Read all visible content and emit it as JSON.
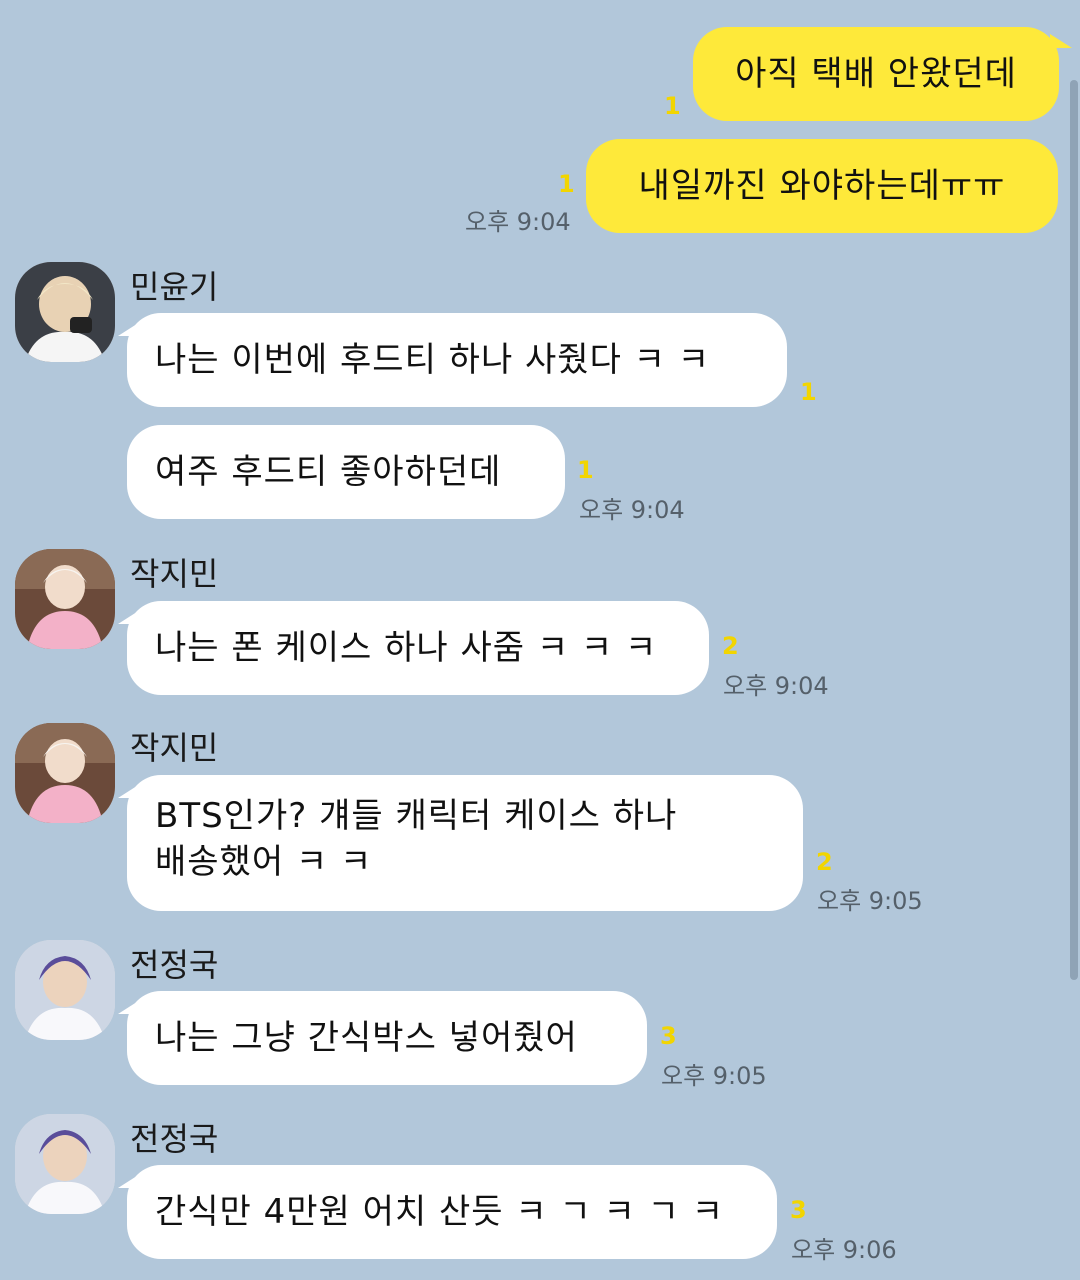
{
  "colors": {
    "background": "#b2c7da",
    "my_bubble": "#fee93a",
    "other_bubble": "#ffffff",
    "unread": "#f2d500",
    "time_text": "#55606a"
  },
  "messages": [
    {
      "text": "아직 택배 안왔던데",
      "unread": "1"
    },
    {
      "text": "내일까진 와야하는데ㅠㅠ",
      "unread": "1",
      "time": "오후 9:04"
    },
    {
      "sender": "민윤기",
      "text": "나는 이번에 후드티 하나 사줬다 ㅋ ㅋ",
      "unread": "1"
    },
    {
      "text": "여주 후드티 좋아하던데",
      "unread": "1",
      "time": "오후 9:04"
    },
    {
      "sender": "작지민",
      "text": "나는 폰 케이스 하나 사줌 ㅋ ㅋ ㅋ",
      "unread": "2",
      "time": "오후 9:04"
    },
    {
      "sender": "작지민",
      "text": "BTS인가? 걔들 캐릭터 케이스 하나\n배송했어 ㅋ ㅋ",
      "unread": "2",
      "time": "오후 9:05"
    },
    {
      "sender": "전정국",
      "text": "나는 그냥 간식박스 넣어줬어",
      "unread": "3",
      "time": "오후 9:05"
    },
    {
      "sender": "전정국",
      "text": "간식만 4만원 어치 산듯 ㅋ ㄱ ㅋ ㄱ ㅋ",
      "unread": "3",
      "time": "오후 9:06"
    }
  ]
}
